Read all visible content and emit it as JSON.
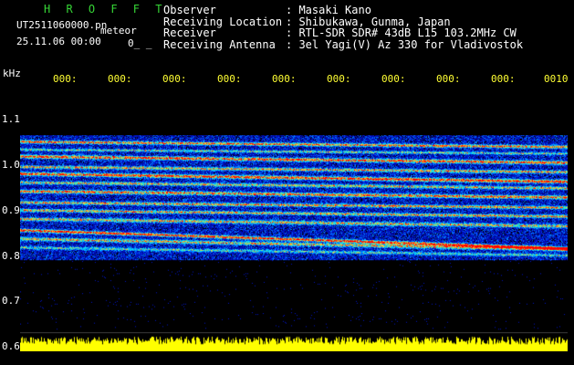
{
  "brand": "H R O F F T",
  "file_name": "UT2511060000.pn",
  "file_suffix": "meteor",
  "datetime": "25.11.06 00:00",
  "extra_marker": "0_ _",
  "info": {
    "labels": [
      "Observer",
      "Receiving Location",
      "Receiver",
      "Receiving Antenna"
    ],
    "values": [
      ": Masaki Kano",
      ": Shibukawa, Gunma, Japan",
      ": RTL-SDR SDR# 43dB L15 103.2MHz CW",
      ": 3el Yagi(V) Az 330 for Vladivostok"
    ]
  },
  "axis": {
    "unit": "kHz",
    "y_ticks": [
      "1.1",
      "1.0",
      "0.9",
      "0.8",
      "0.7",
      "0.6"
    ],
    "x_ticks": [
      "000:",
      "000:",
      "000:",
      "000:",
      "000:",
      "000:",
      "000:",
      "000:",
      "000:",
      "0010"
    ]
  },
  "colors": {
    "background": "#000000",
    "brand": "#36d536",
    "tick_labels": "#ffff33",
    "band_primary": "#ff3333",
    "band_noise": "#1a3ccc",
    "power_trace": "#ffff00"
  }
}
